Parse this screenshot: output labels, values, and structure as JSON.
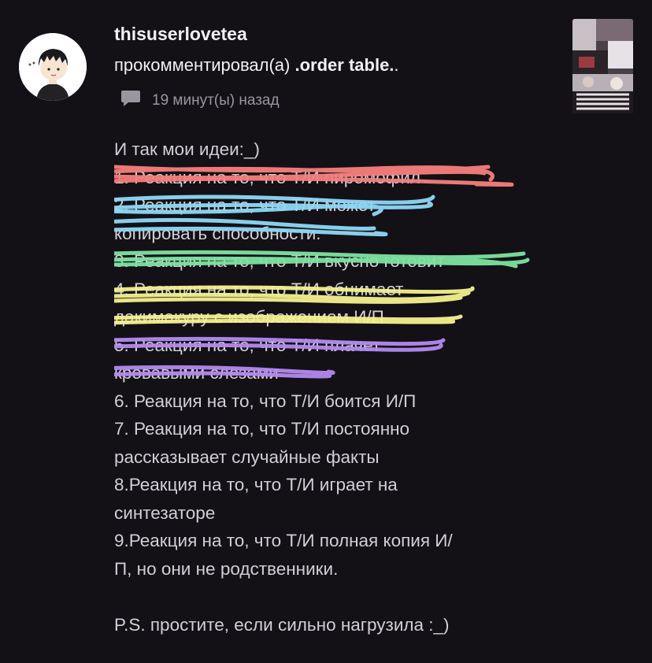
{
  "comment": {
    "username": "thisuserlovetea",
    "action_text": "прокомментировал(а)",
    "target_title": ".order table.",
    "target_suffix": ".",
    "timestamp": "19 минут(ы) назад",
    "icons": {
      "comment": "speech-bubble-icon"
    },
    "lines": [
      "И так мои идеи:_)",
      "1. Реакция на то, что Т/И пиромофил",
      "2. Реакция на то, что Т/И может",
      "копировать способности.",
      "3. Реакция на то, что Т/И вкусно готовит",
      "4. Реакция на то, что Т/И обнимает",
      "дакимакуру с изображением И/П",
      "5. Реакция на то, что Т/И плачет",
      "кровавыми слезами",
      "6. Реакция на то, что Т/И боится И/П",
      "7. Реакция на то, что Т/И постоянно",
      "рассказывает случайные факты",
      "8.Реакция на то, что Т/И играет на",
      "синтезаторе",
      "9.Реакция на то, что Т/И полная копия И/",
      "П, но они не родственники.",
      "",
      "P.S. простите, если сильно нагрузила :_)"
    ]
  },
  "colors": {
    "background": "#131115",
    "strike_red": "#f77f7d",
    "strike_blue": "#8fd9f7",
    "strike_green": "#7ee3a2",
    "strike_yellow": "#f4f28f",
    "strike_purple": "#b48af2"
  }
}
